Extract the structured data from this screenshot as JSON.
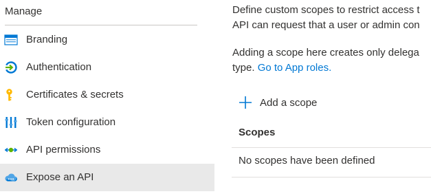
{
  "sidebar": {
    "section_title": "Manage",
    "items": [
      {
        "label": "Branding",
        "icon": "branding-icon",
        "selected": false
      },
      {
        "label": "Authentication",
        "icon": "authentication-icon",
        "selected": false
      },
      {
        "label": "Certificates & secrets",
        "icon": "key-icon",
        "selected": false
      },
      {
        "label": "Token configuration",
        "icon": "token-configuration-icon",
        "selected": false
      },
      {
        "label": "API permissions",
        "icon": "api-permissions-icon",
        "selected": false
      },
      {
        "label": "Expose an API",
        "icon": "cloud-api-icon",
        "selected": true
      }
    ]
  },
  "main": {
    "description_line1": "Define custom scopes to restrict access t",
    "description_line2": "API can request that a user or admin con",
    "info_line1": "Adding a scope here creates only delega",
    "info_line2_prefix": "type. ",
    "info_link": "Go to App roles.",
    "add_scope_label": "Add a scope",
    "table": {
      "header": "Scopes",
      "empty_message": "No scopes have been defined"
    }
  },
  "colors": {
    "accent": "#0078d4",
    "selected_bg": "#e9e9e9",
    "text": "#323130",
    "divider": "#e1dfdd"
  }
}
